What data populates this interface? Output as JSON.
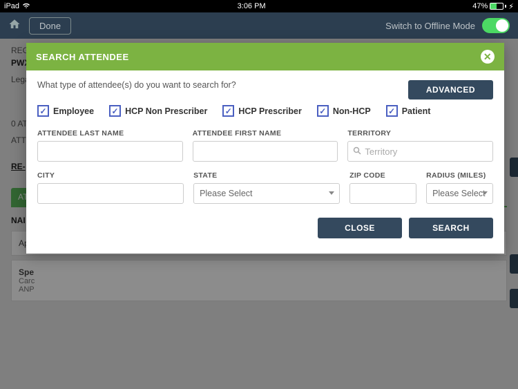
{
  "status": {
    "carrier": "iPad",
    "time": "3:06 PM",
    "battery_pct": "47%"
  },
  "nav": {
    "done": "Done",
    "offline": "Switch to Offline Mode"
  },
  "bg": {
    "reg": "REG",
    "pwx": "PWX",
    "legal": "Lega",
    "zero_at": "0 AT",
    "att": "ATT",
    "re": "RE-",
    "tab": "AT",
    "name": "NAI",
    "app": "App",
    "spe": "Spe",
    "caro": "Carc",
    "anp": "ANP"
  },
  "modal": {
    "title": "SEARCH ATTENDEE",
    "prompt": "What type of attendee(s) do you want to search for?",
    "advanced": "ADVANCED",
    "checks": [
      "Employee",
      "HCP Non Prescriber",
      "HCP Prescriber",
      "Non-HCP",
      "Patient"
    ],
    "labels": {
      "last": "ATTENDEE LAST NAME",
      "first": "ATTENDEE FIRST NAME",
      "territory": "TERRITORY",
      "city": "CITY",
      "state": "STATE",
      "zip": "ZIP CODE",
      "radius": "RADIUS (MILES)"
    },
    "placeholders": {
      "territory": "Territory"
    },
    "selects": {
      "state": "Please Select",
      "radius": "Please Select"
    },
    "close": "CLOSE",
    "search": "SEARCH"
  }
}
